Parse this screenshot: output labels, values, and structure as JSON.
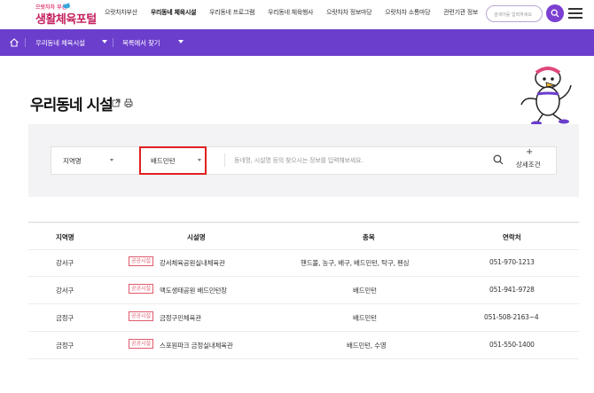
{
  "header": {
    "logo_top": "으랏차차 부산",
    "logo_main": "생활체육포털",
    "nav": [
      "으랏차차부산",
      "우리동네 체육시설",
      "우리동네 프로그램",
      "우리동네 체육행사",
      "으랏차차 정보마당",
      "으랏차차 소통마당",
      "관련기관 정보"
    ],
    "search_placeholder": "검색어를 입력하세요"
  },
  "breadcrumb": {
    "items": [
      "우리동네 체육시설",
      "목록에서 찾기"
    ]
  },
  "page": {
    "title": "우리동네 시설"
  },
  "search": {
    "region_label": "지역명",
    "sport_label": "배드민턴",
    "placeholder": "동네명, 시설명 등의 찾으시는 정보를 입력해보세요.",
    "detail_plus": "+",
    "detail_label": "상세조건"
  },
  "table": {
    "headers": [
      "지역명",
      "시설명",
      "종목",
      "연락처"
    ],
    "rows": [
      {
        "region": "강서구",
        "badge": "공공시설",
        "facility": "강서체육공원실내체육관",
        "sports": "핸드볼, 농구, 배구, 배드민턴, 탁구, 펜싱",
        "phone": "051-970-1213"
      },
      {
        "region": "강서구",
        "badge": "공공시설",
        "facility": "맥도생태공원 배드민턴장",
        "sports": "배드민턴",
        "phone": "051-941-9728"
      },
      {
        "region": "금정구",
        "badge": "공공시설",
        "facility": "금정구민체육관",
        "sports": "배드민턴",
        "phone": "051-508-2163~4"
      },
      {
        "region": "금정구",
        "badge": "공공시설",
        "facility": "스포원파크 금정실내체육관",
        "sports": "배드민턴, 수영",
        "phone": "051-550-1400"
      }
    ]
  },
  "colors": {
    "brand_purple": "#6b3ecc",
    "brand_pink": "#c4205e",
    "highlight_red": "#e02020",
    "badge_pink": "#e05a6c"
  }
}
